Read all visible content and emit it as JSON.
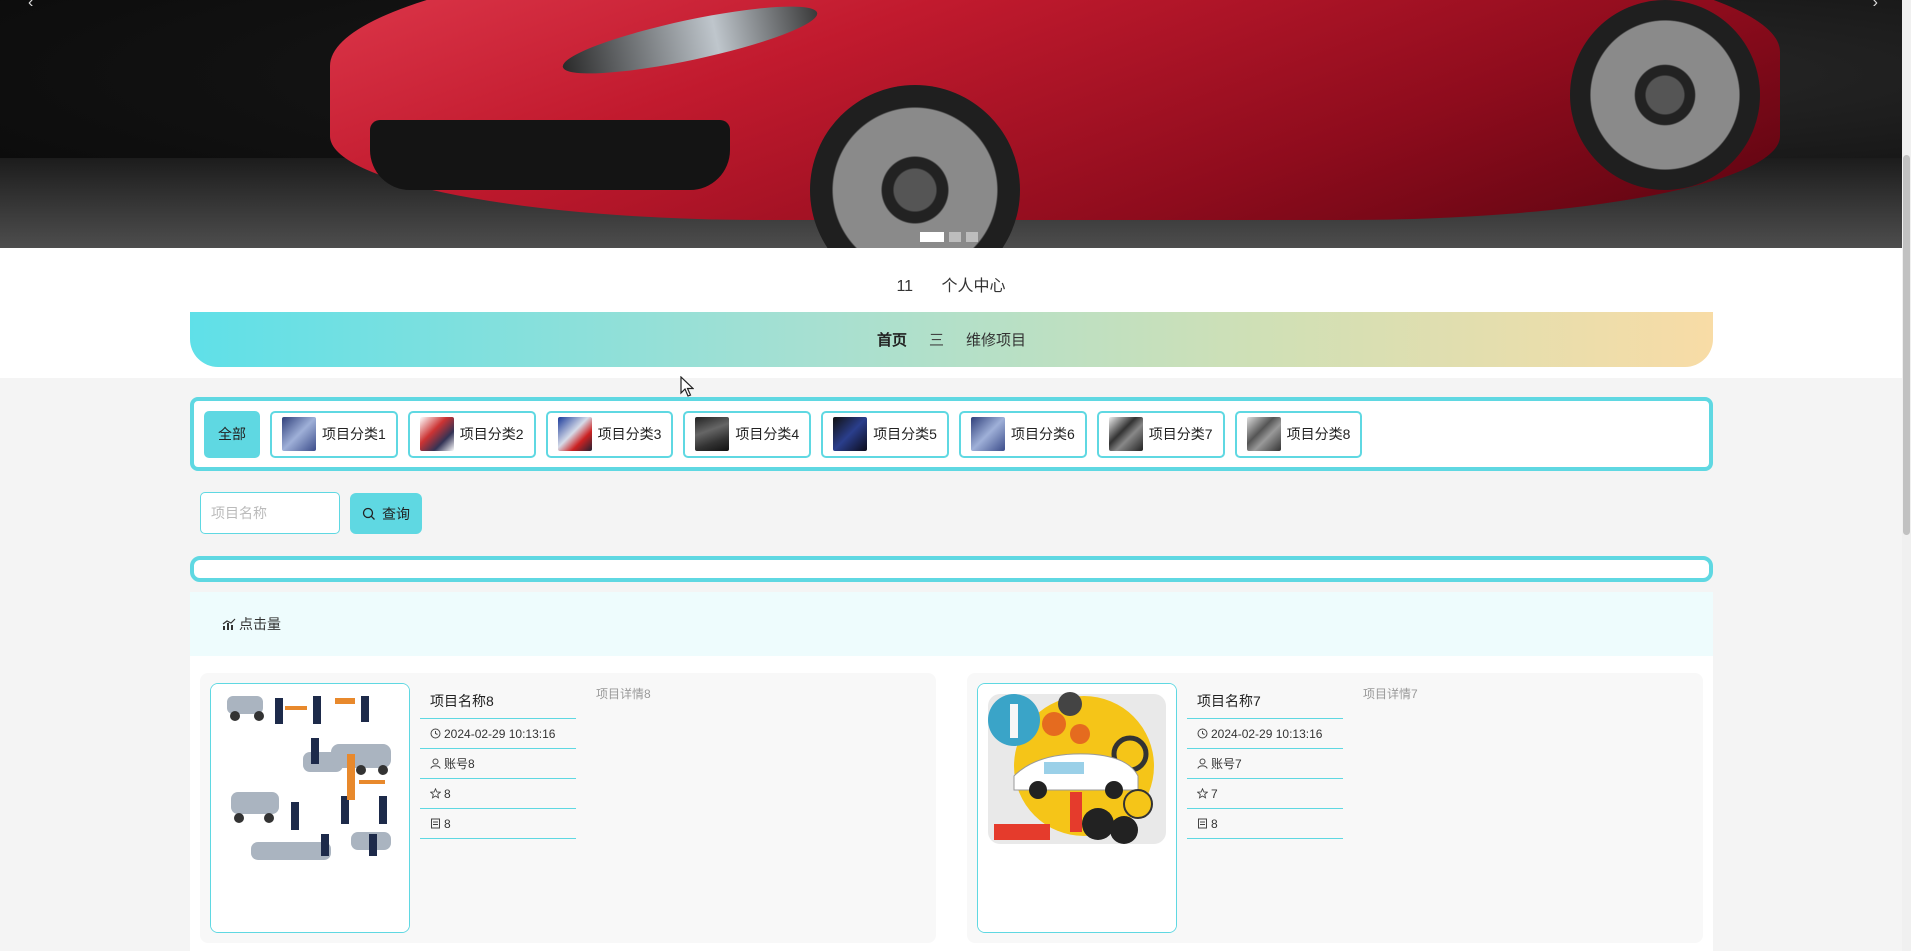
{
  "user_bar": {
    "user": "11",
    "center": "个人中心"
  },
  "nav": {
    "home": "首页",
    "sep": "三",
    "current": "维修项目"
  },
  "categories": [
    {
      "label": "全部"
    },
    {
      "label": "项目分类1"
    },
    {
      "label": "项目分类2"
    },
    {
      "label": "项目分类3"
    },
    {
      "label": "项目分类4"
    },
    {
      "label": "项目分类5"
    },
    {
      "label": "项目分类6"
    },
    {
      "label": "项目分类7"
    },
    {
      "label": "项目分类8"
    }
  ],
  "search": {
    "placeholder": "项目名称",
    "button": "查询"
  },
  "sort": {
    "label": "点击量"
  },
  "items": [
    {
      "name": "项目名称8",
      "time": "2024-02-29 10:13:16",
      "account": "账号8",
      "star": "8",
      "count": "8",
      "detail": "项目详情8"
    },
    {
      "name": "项目名称7",
      "time": "2024-02-29 10:13:16",
      "account": "账号7",
      "star": "7",
      "count": "8",
      "detail": "项目详情7"
    }
  ],
  "colors": {
    "accent": "#5fd8e2",
    "nav_start": "#5fe0e8",
    "nav_end": "#f8dca6"
  }
}
